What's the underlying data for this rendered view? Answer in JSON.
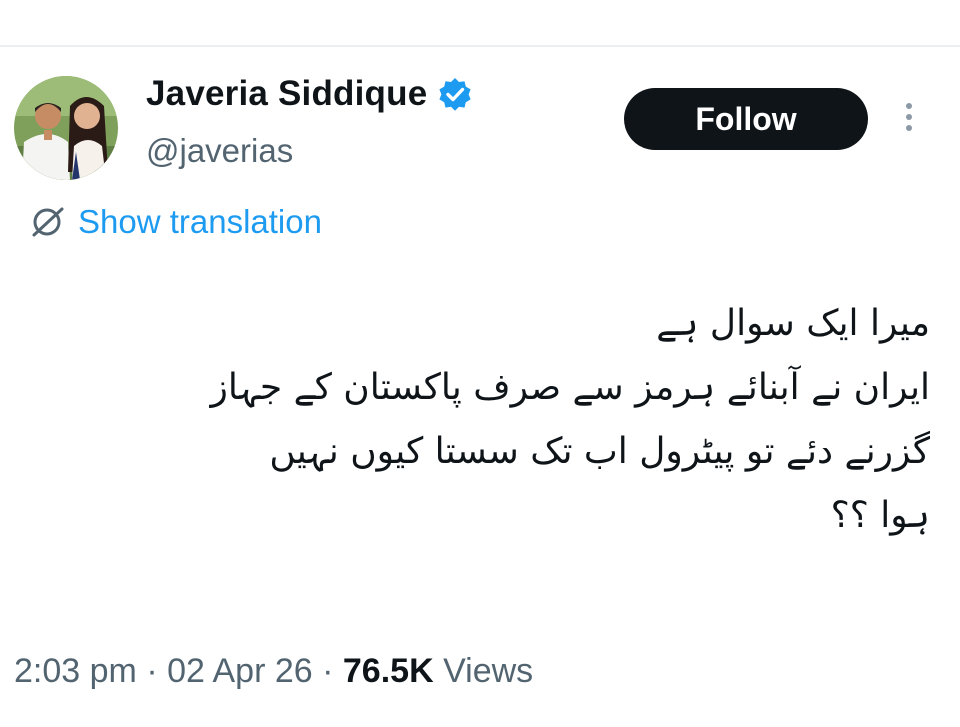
{
  "author": {
    "name": "Javeria Siddique",
    "handle": "@javerias",
    "verified_icon": "verified-badge-icon",
    "avatar_icon": "profile-photo"
  },
  "actions": {
    "follow_label": "Follow",
    "more_icon": "more-vertical-icon"
  },
  "translation": {
    "icon": "translate-globe-icon",
    "label": "Show translation"
  },
  "tweet": {
    "lines": [
      "میرا ایک سوال ہے",
      "ایران نے آبنائے ہرمز سے صرف پاکستان کے جہاز",
      "گزرنے دئے تو پیٹرول اب تک سستا کیوں نہیں",
      "ہوا ؟؟"
    ]
  },
  "meta": {
    "time": "2:03 pm",
    "separator": "·",
    "date": "02 Apr 26",
    "views_count": "76.5K",
    "views_label": "Views"
  },
  "colors": {
    "accent": "#1d9bf0",
    "text": "#0f1419",
    "secondary": "#536471",
    "follow_bg": "#0f1419"
  }
}
